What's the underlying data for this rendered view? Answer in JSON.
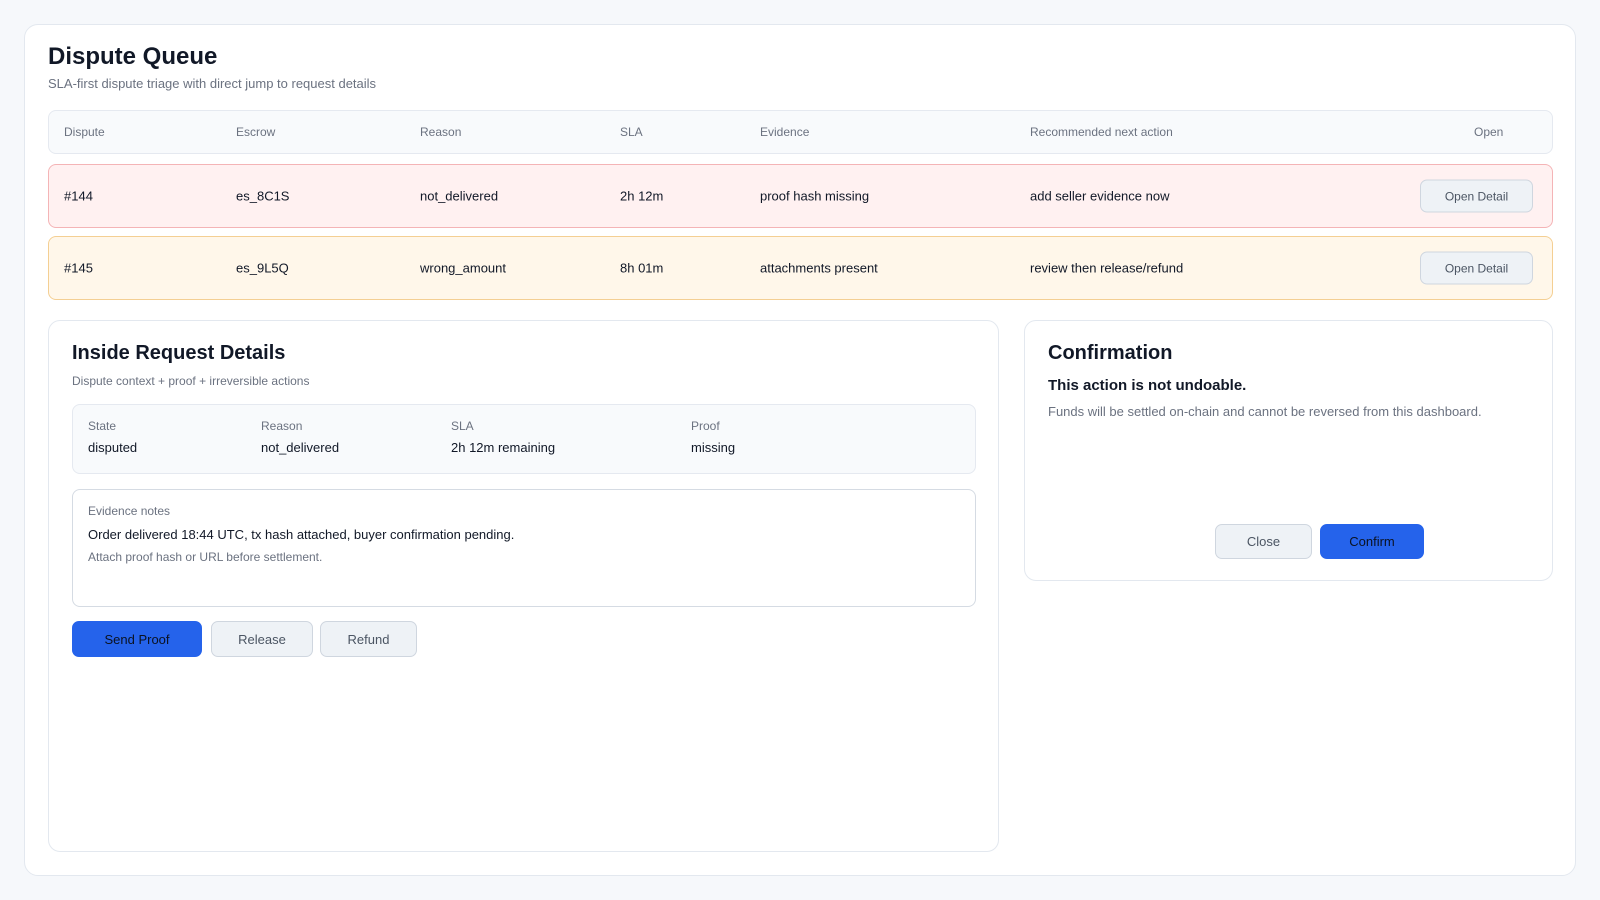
{
  "header": {
    "title": "Dispute Queue",
    "subtitle": "SLA-first dispute triage with direct jump to request details"
  },
  "queue": {
    "columns": [
      "Dispute",
      "Escrow",
      "Reason",
      "SLA",
      "Evidence",
      "Recommended next action",
      "Open"
    ],
    "rows": [
      {
        "dispute": "#144",
        "escrow": "es_8C1S",
        "reason": "not_delivered",
        "sla": "2h 12m",
        "evidence": "proof hash missing",
        "next_action": "add seller evidence now",
        "open_label": "Open Detail",
        "severity": "critical"
      },
      {
        "dispute": "#145",
        "escrow": "es_9L5Q",
        "reason": "wrong_amount",
        "sla": "8h 01m",
        "evidence": "attachments present",
        "next_action": "review then release/refund",
        "open_label": "Open Detail",
        "severity": "warning"
      }
    ]
  },
  "details": {
    "title": "Inside Request Details",
    "subtitle": "Dispute context + proof + irreversible actions",
    "facts": [
      {
        "label": "State",
        "value": "disputed"
      },
      {
        "label": "Reason",
        "value": "not_delivered"
      },
      {
        "label": "SLA",
        "value": "2h 12m remaining"
      },
      {
        "label": "Proof",
        "value": "missing"
      }
    ],
    "notes": {
      "label": "Evidence notes",
      "text": "Order delivered 18:44 UTC, tx hash attached, buyer confirmation pending.",
      "hint": "Attach proof hash or URL before settlement."
    },
    "actions": {
      "send_proof": "Send Proof",
      "release": "Release",
      "refund": "Refund"
    }
  },
  "confirmation": {
    "title": "Confirmation",
    "warning": "This action is not undoable.",
    "body": "Funds will be settled on-chain and cannot be reversed from this dashboard.",
    "close_label": "Close",
    "confirm_label": "Confirm"
  },
  "colors": {
    "accent": "#2563eb",
    "critical_bg": "#fff1f1",
    "critical_border": "#f4b4b6",
    "warning_bg": "#fff7ea",
    "warning_border": "#f4cf93"
  }
}
